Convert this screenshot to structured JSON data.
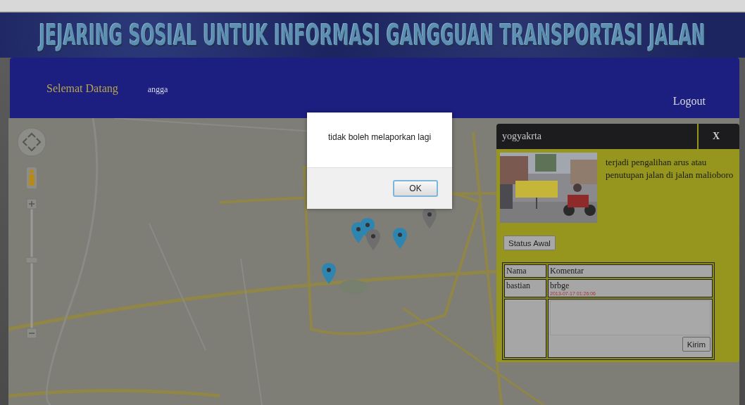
{
  "header": {
    "title": "JEJARING SOSIAL UNTUK INFORMASI GANGGUAN TRANSPORTASI JALAN"
  },
  "nav": {
    "greeting": "Selemat Datang",
    "user": "angga",
    "logout": "Logout"
  },
  "map": {
    "kind": "picture",
    "markers": [
      {
        "color": "#2e86b0"
      },
      {
        "color": "#2e86b0"
      },
      {
        "color": "#6e6e6e"
      },
      {
        "color": "#2e86b0"
      },
      {
        "color": "#6e6e6e"
      },
      {
        "color": "#2e86b0"
      }
    ]
  },
  "dialog": {
    "message": "tidak boleh melaporkan lagi",
    "button": "OK"
  },
  "panel": {
    "title": "yogyakrta",
    "close": "X",
    "description": "terjadi pengalihan arus atau penutupan jalan di jalan malioboro",
    "status_button": "Status Awal",
    "comments": {
      "columns": [
        "Nama",
        "Komentar"
      ],
      "rows": [
        {
          "name": "bastian",
          "text": "brbge",
          "time": "2013-07-17 01:26:06"
        }
      ],
      "submit": "Kirim"
    }
  }
}
